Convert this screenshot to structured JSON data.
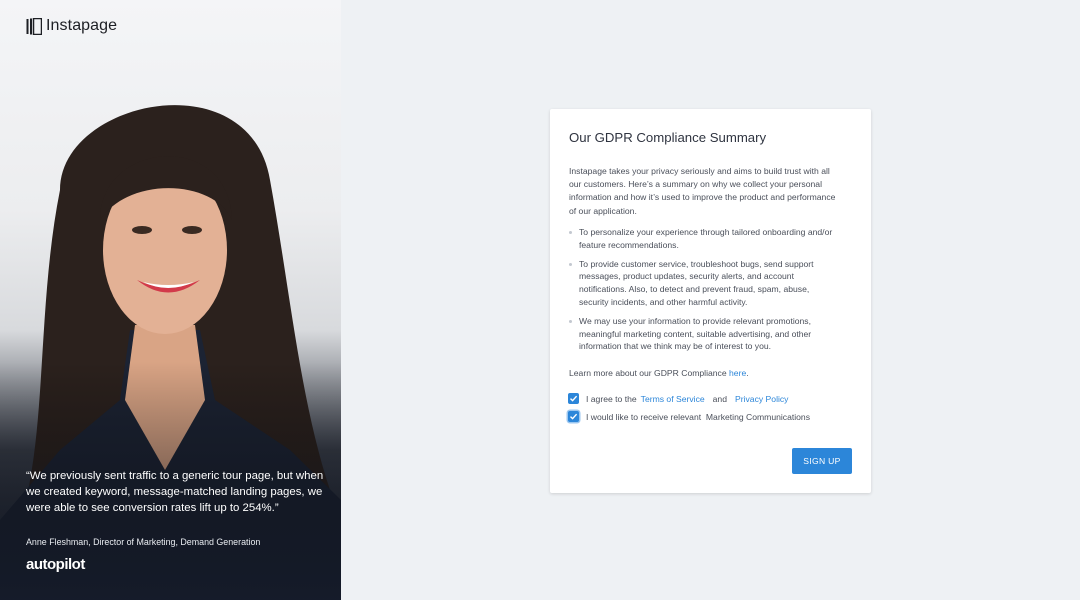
{
  "hero": {
    "logo_text": "Instapage",
    "quote": "“We previously sent traffic to a generic tour page, but when we created keyword, message-matched landing pages, we were able to see conversion rates lift up to 254%.”",
    "author": "Anne Fleshman, Director of Marketing, Demand Generation",
    "brand": "autopilot"
  },
  "card": {
    "title": "Our GDPR Compliance Summary",
    "intro": "Instapage takes your privacy seriously and aims to build trust with all our customers. Here’s a summary on why we collect your personal information and how it’s used to improve the product and performance of our application.",
    "bullets": [
      "To personalize your experience through tailored onboarding and/or feature recommendations.",
      "To provide customer service, troubleshoot bugs, send support messages, product updates, security alerts, and account notifications. Also, to detect and prevent fraud, spam, abuse, security incidents, and other harmful activity.",
      "We may use your information to provide relevant promotions, meaningful marketing content, suitable advertising, and other information that we think may be of interest to you."
    ],
    "learn_more_prefix": "Learn more about our GDPR Compliance",
    "learn_more_link": "here",
    "learn_more_suffix": ".",
    "agree_prefix": "I agree to the",
    "terms_link": "Terms of Service",
    "agree_and": "and",
    "privacy_link": "Privacy Policy",
    "marketing_label": "I would like to receive relevant  Marketing Communications",
    "signup_label": "SIGN UP"
  },
  "colors": {
    "accent": "#2c86d9",
    "background": "#eef1f4"
  }
}
